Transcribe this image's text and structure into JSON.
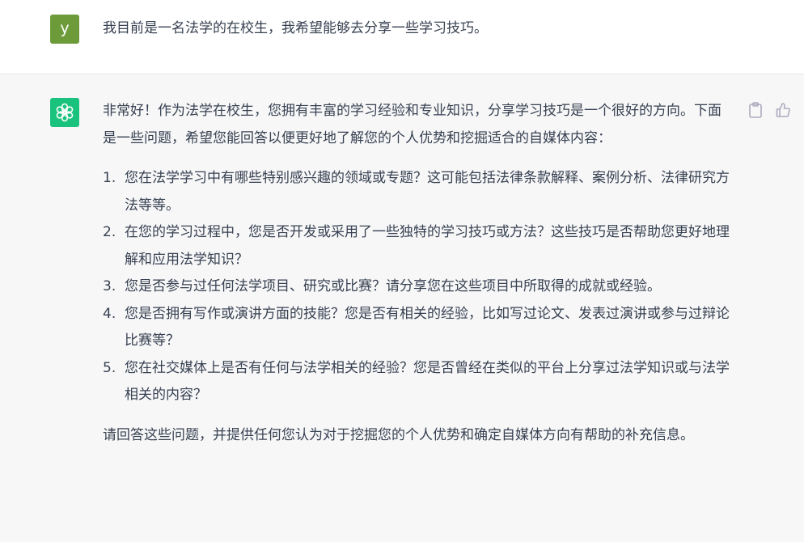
{
  "user_message": {
    "avatar_letter": "y",
    "text": "我目前是一名法学的在校生，我希望能够去分享一些学习技巧。"
  },
  "assistant_message": {
    "intro": "非常好！作为法学在校生，您拥有丰富的学习经验和专业知识，分享学习技巧是一个很好的方向。下面是一些问题，希望您能回答以便更好地了解您的个人优势和挖掘适合的自媒体内容：",
    "questions": [
      {
        "num": "1.",
        "text": "您在法学学习中有哪些特别感兴趣的领域或专题？这可能包括法律条款解释、案例分析、法律研究方法等等。"
      },
      {
        "num": "2.",
        "text": "在您的学习过程中，您是否开发或采用了一些独特的学习技巧或方法？这些技巧是否帮助您更好地理解和应用法学知识？"
      },
      {
        "num": "3.",
        "text": "您是否参与过任何法学项目、研究或比赛？请分享您在这些项目中所取得的成就或经验。"
      },
      {
        "num": "4.",
        "text": "您是否拥有写作或演讲方面的技能？您是否有相关的经验，比如写过论文、发表过演讲或参与过辩论比赛等？"
      },
      {
        "num": "5.",
        "text": "您在社交媒体上是否有任何与法学相关的经验？您是否曾经在类似的平台上分享过法学知识或与法学相关的内容？"
      }
    ],
    "closing": "请回答这些问题，并提供任何您认为对于挖掘您的个人优势和确定自媒体方向有帮助的补充信息。"
  },
  "icons": {
    "assistant_avatar": "openai-logo-icon",
    "copy": "clipboard-icon",
    "thumbs_up": "thumbs-up-icon"
  },
  "colors": {
    "user_avatar_bg": "#6d9b3a",
    "assistant_avatar_bg": "#19c37d",
    "assistant_row_bg": "#f7f7f8",
    "text": "#374151",
    "icon": "#acacbe"
  }
}
